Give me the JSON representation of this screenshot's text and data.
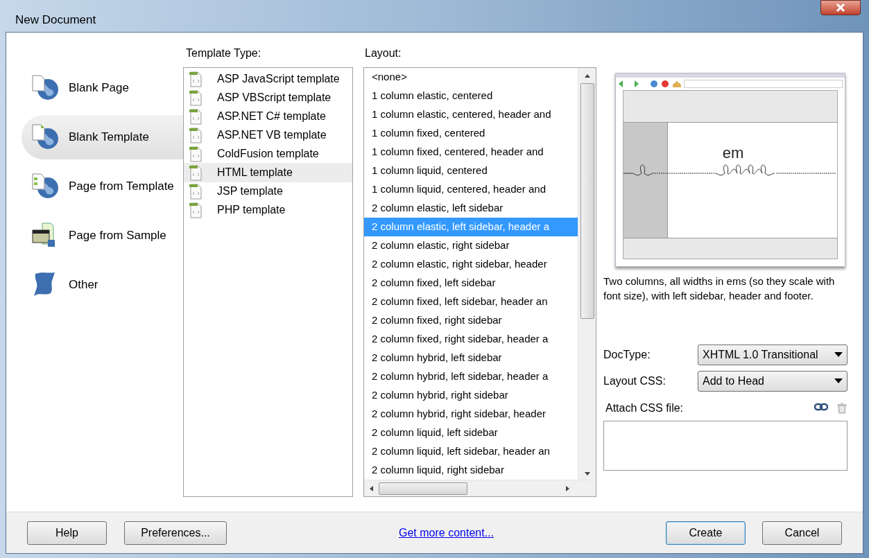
{
  "window": {
    "title": "New Document"
  },
  "categories": [
    {
      "label": "Blank Page",
      "kind": "blank-page",
      "selected": false
    },
    {
      "label": "Blank Template",
      "kind": "blank-template",
      "selected": true
    },
    {
      "label": "Page from Template",
      "kind": "page-from-template",
      "selected": false
    },
    {
      "label": "Page from Sample",
      "kind": "page-from-sample",
      "selected": false
    },
    {
      "label": "Other",
      "kind": "other",
      "selected": false
    }
  ],
  "template_type": {
    "label": "Template Type:",
    "items": [
      {
        "label": "ASP JavaScript template",
        "selected": false
      },
      {
        "label": "ASP VBScript template",
        "selected": false
      },
      {
        "label": "ASP.NET C# template",
        "selected": false
      },
      {
        "label": "ASP.NET VB template",
        "selected": false
      },
      {
        "label": "ColdFusion template",
        "selected": false
      },
      {
        "label": "HTML template",
        "selected": true
      },
      {
        "label": "JSP template",
        "selected": false
      },
      {
        "label": "PHP template",
        "selected": false
      }
    ]
  },
  "layout": {
    "label": "Layout:",
    "items": [
      {
        "label": "<none>",
        "selected": false
      },
      {
        "label": "1 column elastic, centered",
        "selected": false
      },
      {
        "label": "1 column elastic, centered, header and",
        "selected": false
      },
      {
        "label": "1 column fixed, centered",
        "selected": false
      },
      {
        "label": "1 column fixed, centered, header and",
        "selected": false
      },
      {
        "label": "1 column liquid, centered",
        "selected": false
      },
      {
        "label": "1 column liquid, centered, header and",
        "selected": false
      },
      {
        "label": "2 column elastic, left sidebar",
        "selected": false
      },
      {
        "label": "2 column elastic, left sidebar, header a",
        "selected": true
      },
      {
        "label": "2 column elastic, right sidebar",
        "selected": false
      },
      {
        "label": "2 column elastic, right sidebar, header",
        "selected": false
      },
      {
        "label": "2 column fixed, left sidebar",
        "selected": false
      },
      {
        "label": "2 column fixed, left sidebar, header an",
        "selected": false
      },
      {
        "label": "2 column fixed, right sidebar",
        "selected": false
      },
      {
        "label": "2 column fixed, right sidebar, header a",
        "selected": false
      },
      {
        "label": "2 column hybrid, left sidebar",
        "selected": false
      },
      {
        "label": "2 column hybrid, left sidebar, header a",
        "selected": false
      },
      {
        "label": "2 column hybrid, right sidebar",
        "selected": false
      },
      {
        "label": "2 column hybrid, right sidebar, header",
        "selected": false
      },
      {
        "label": "2 column liquid, left sidebar",
        "selected": false
      },
      {
        "label": "2 column liquid, left sidebar, header an",
        "selected": false
      },
      {
        "label": "2 column liquid, right sidebar",
        "selected": false
      }
    ]
  },
  "preview": {
    "caption": "em"
  },
  "description": "Two columns, all widths in ems (so they scale with font size), with left sidebar, header and footer.",
  "doctype": {
    "label": "DocType:",
    "value": "XHTML 1.0 Transitional"
  },
  "layout_css": {
    "label": "Layout CSS:",
    "value": "Add to Head"
  },
  "attach_css": {
    "label": "Attach CSS file:"
  },
  "buttons": {
    "help": "Help",
    "preferences": "Preferences...",
    "link": "Get more content...",
    "create": "Create",
    "cancel": "Cancel"
  }
}
